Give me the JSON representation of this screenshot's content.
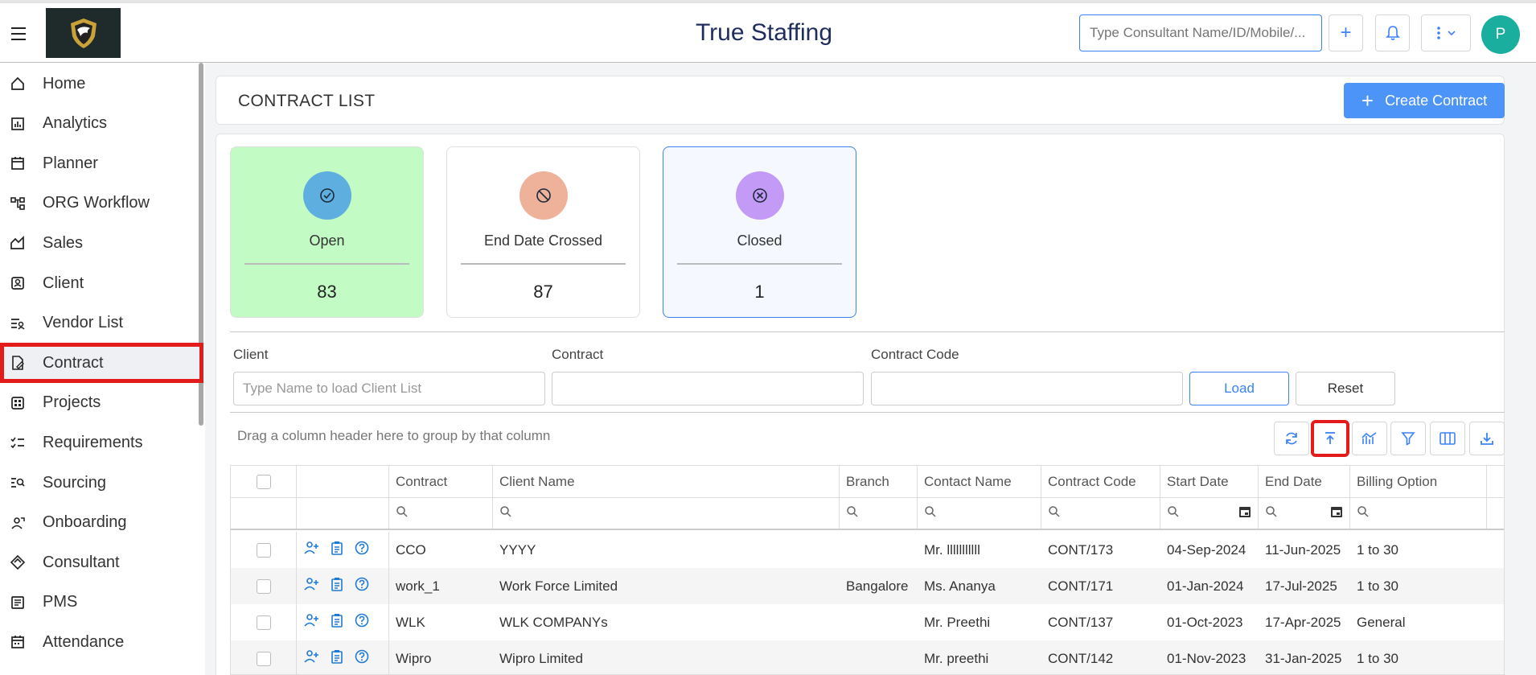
{
  "header": {
    "app_title": "True Staffing",
    "search_placeholder": "Type Consultant Name/ID/Mobile/...",
    "add_label": "+",
    "avatar_initial": "P"
  },
  "sidebar": {
    "items": [
      {
        "label": "Home",
        "icon": "home-icon"
      },
      {
        "label": "Analytics",
        "icon": "analytics-icon"
      },
      {
        "label": "Planner",
        "icon": "calendar-icon"
      },
      {
        "label": "ORG Workflow",
        "icon": "workflow-icon"
      },
      {
        "label": "Sales",
        "icon": "sales-icon"
      },
      {
        "label": "Client",
        "icon": "client-icon"
      },
      {
        "label": "Vendor List",
        "icon": "vendor-list-icon"
      },
      {
        "label": "Contract",
        "icon": "contract-icon",
        "active": true
      },
      {
        "label": "Projects",
        "icon": "projects-icon"
      },
      {
        "label": "Requirements",
        "icon": "requirements-icon"
      },
      {
        "label": "Sourcing",
        "icon": "sourcing-icon"
      },
      {
        "label": "Onboarding",
        "icon": "onboarding-icon"
      },
      {
        "label": "Consultant",
        "icon": "consultant-icon"
      },
      {
        "label": "PMS",
        "icon": "pms-icon"
      },
      {
        "label": "Attendance",
        "icon": "attendance-icon"
      }
    ]
  },
  "page": {
    "title": "CONTRACT LIST",
    "create_label": "Create Contract"
  },
  "stats": [
    {
      "label": "Open",
      "value": "83",
      "color": "#c3fbc4",
      "circle": "#5faee0"
    },
    {
      "label": "End Date Crossed",
      "value": "87",
      "color": "#ffffff",
      "circle": "#eeb19a"
    },
    {
      "label": "Closed",
      "value": "1",
      "color": "#f5f9ff",
      "circle": "#c49af7"
    }
  ],
  "filters": {
    "client_label": "Client",
    "client_placeholder": "Type Name to load Client List",
    "contract_label": "Contract",
    "contract_code_label": "Contract Code",
    "load_label": "Load",
    "reset_label": "Reset"
  },
  "grid": {
    "group_hint": "Drag a column header here to group by that column",
    "columns": [
      "Contract",
      "Client Name",
      "Branch",
      "Contact Name",
      "Contract Code",
      "Start Date",
      "End Date",
      "Billing Option"
    ],
    "rows": [
      {
        "contract": "CCO",
        "client": "YYYY",
        "branch": "",
        "contact": "Mr. lllllllllll",
        "code": "CONT/173",
        "start": "04-Sep-2024",
        "end": "11-Jun-2025",
        "billing": "1 to 30"
      },
      {
        "contract": "work_1",
        "client": "Work Force Limited",
        "branch": "Bangalore",
        "contact": "Ms. Ananya",
        "code": "CONT/171",
        "start": "01-Jan-2024",
        "end": "17-Jul-2025",
        "billing": "1 to 30"
      },
      {
        "contract": "WLK",
        "client": "WLK COMPANYs",
        "branch": "",
        "contact": "Mr. Preethi",
        "code": "CONT/137",
        "start": "01-Oct-2023",
        "end": "17-Apr-2025",
        "billing": "General"
      },
      {
        "contract": "Wipro",
        "client": "Wipro Limited",
        "branch": "",
        "contact": "Mr. preethi",
        "code": "CONT/142",
        "start": "01-Nov-2023",
        "end": "31-Jan-2025",
        "billing": "1 to 30"
      }
    ]
  }
}
